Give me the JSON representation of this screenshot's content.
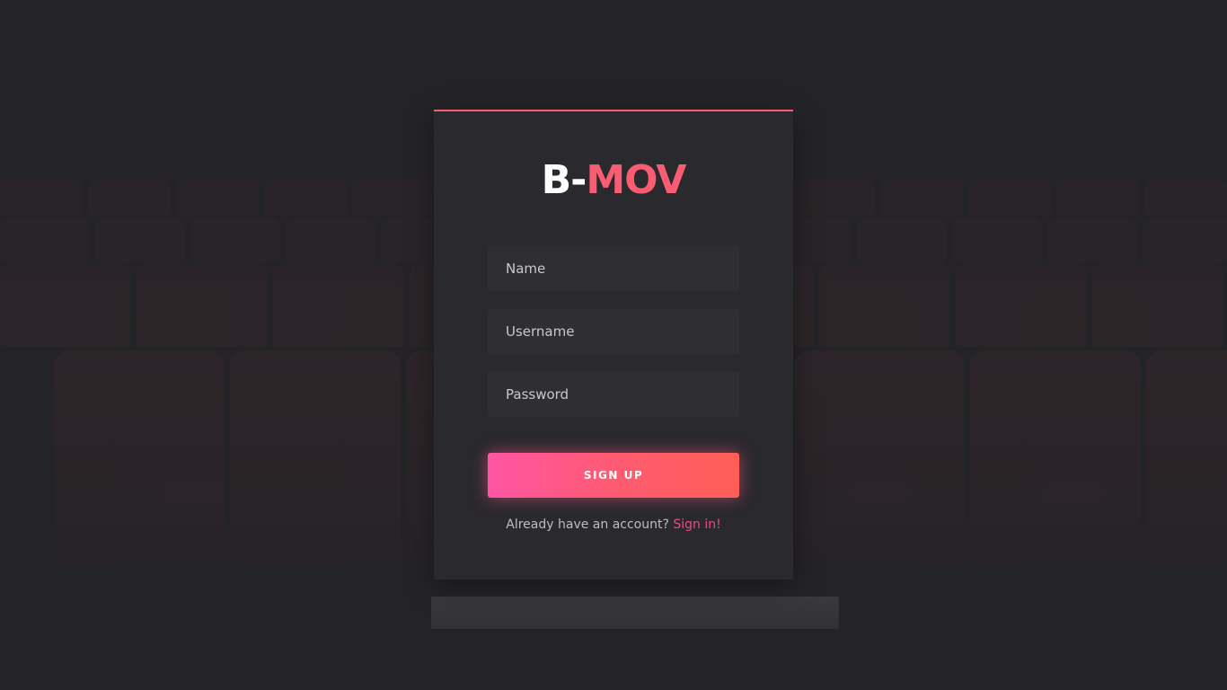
{
  "logo": {
    "part1": "B-",
    "part2": "MOV"
  },
  "form": {
    "name_placeholder": "Name",
    "username_placeholder": "Username",
    "password_placeholder": "Password",
    "submit_label": "SIGN UP"
  },
  "footer": {
    "prompt": "Already have an account?",
    "link_label": "Sign in!"
  },
  "colors": {
    "accent": "#fa5c72",
    "link": "#e54e86",
    "card_background": "#2a292e",
    "field_background": "#2f2e33"
  }
}
